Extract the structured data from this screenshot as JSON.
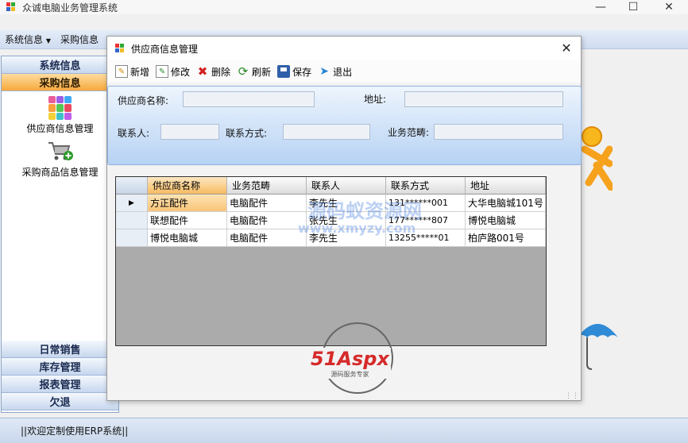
{
  "window": {
    "title": "众诚电脑业务管理系统"
  },
  "menu": {
    "items": [
      "系统信息",
      "采购信息"
    ]
  },
  "nav": {
    "groups_top": [
      "系统信息",
      "采购信息"
    ],
    "entries": [
      "供应商信息管理",
      "采购商品信息管理"
    ],
    "groups_bottom": [
      "日常销售",
      "库存管理",
      "报表管理",
      "欠退"
    ]
  },
  "status": {
    "text": "||欢迎定制使用ERP系统||"
  },
  "dialog": {
    "title": "供应商信息管理",
    "toolbar": {
      "new": "新增",
      "edit": "修改",
      "delete": "删除",
      "refresh": "刷新",
      "save": "保存",
      "exit": "退出"
    },
    "filters": {
      "name_label": "供应商名称:",
      "address_label": "地址:",
      "contact_label": "联系人:",
      "phone_label": "联系方式:",
      "scope_label": "业务范畴:"
    },
    "grid": {
      "columns": [
        "供应商名称",
        "业务范畴",
        "联系人",
        "联系方式",
        "地址"
      ],
      "rows": [
        [
          "方正配件",
          "电脑配件",
          "李先生",
          "131******001",
          "大华电脑城101号"
        ],
        [
          "联想配件",
          "电脑配件",
          "张先生",
          "177******807",
          "博悦电脑城"
        ],
        [
          "博悦电脑城",
          "电脑配件",
          "李先生",
          "13255*****01",
          "柏庐路001号"
        ]
      ]
    }
  },
  "watermark": {
    "text1": "源码蚁资源网",
    "text2": "www.xmyzy.com",
    "logo": "51Aspx",
    "logo_sub": "源码服务专家"
  }
}
